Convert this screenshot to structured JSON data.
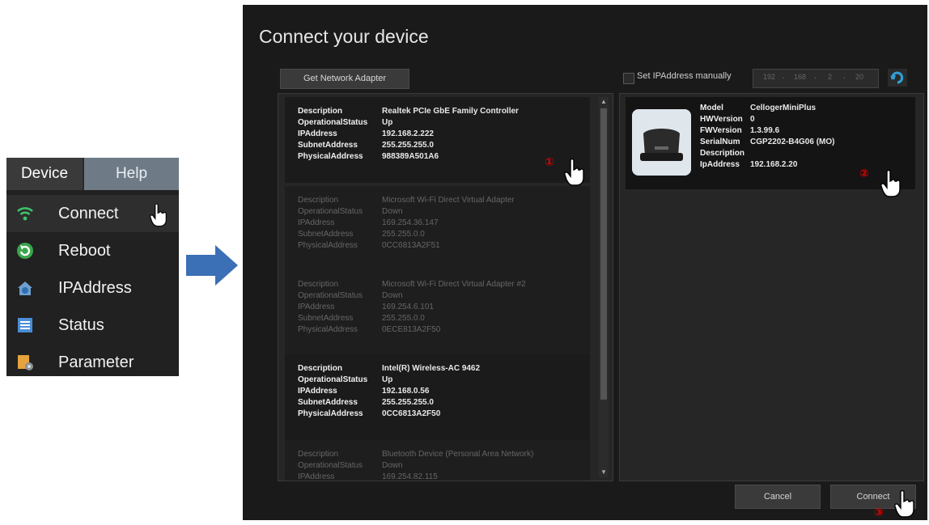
{
  "menu": {
    "tabs": [
      "Device",
      "Help"
    ],
    "items": [
      {
        "icon": "wifi-icon",
        "label": "Connect"
      },
      {
        "icon": "reboot-icon",
        "label": "Reboot"
      },
      {
        "icon": "ipaddress-icon",
        "label": "IPAddress"
      },
      {
        "icon": "status-icon",
        "label": "Status"
      },
      {
        "icon": "parameter-icon",
        "label": "Parameter"
      }
    ]
  },
  "dialog": {
    "title": "Connect your device",
    "get_adapter_label": "Get Network Adapter",
    "set_ip_label": "Set IPAddress manually",
    "ip_segments": [
      "192",
      "168",
      "2",
      "20"
    ],
    "adapters": [
      {
        "Description": "Realtek PCIe GbE Family Controller",
        "OperationalStatus": "Up",
        "IPAddress": "192.168.2.222",
        "SubnetAddress": "255.255.255.0",
        "PhysicalAddress": "988389A501A6"
      },
      {
        "Description": "Microsoft Wi-Fi Direct Virtual Adapter",
        "OperationalStatus": "Down",
        "IPAddress": "169.254.36.147",
        "SubnetAddress": "255.255.0.0",
        "PhysicalAddress": "0CC6813A2F51"
      },
      {
        "Description": "Microsoft Wi-Fi Direct Virtual Adapter #2",
        "OperationalStatus": "Down",
        "IPAddress": "169.254.6.101",
        "SubnetAddress": "255.255.0.0",
        "PhysicalAddress": "0ECE813A2F50"
      },
      {
        "Description": "Intel(R) Wireless-AC 9462",
        "OperationalStatus": "Up",
        "IPAddress": "192.168.0.56",
        "SubnetAddress": "255.255.255.0",
        "PhysicalAddress": "0CC6813A2F50"
      },
      {
        "Description": "Bluetooth Device (Personal Area Network)",
        "OperationalStatus": "Down",
        "IPAddress": "169.254.82.115",
        "SubnetAddress": "",
        "PhysicalAddress": ""
      }
    ],
    "device": {
      "Model": "CellogerMiniPlus",
      "HWVersion": "0",
      "FWVersion": "1.3.99.6",
      "SerialNum": "CGP2202-B4G06 (MO)",
      "Description": "",
      "IpAddress": "192.168.2.20"
    },
    "cancel_label": "Cancel",
    "connect_label": "Connect"
  },
  "steps": [
    "①",
    "②",
    "③"
  ]
}
